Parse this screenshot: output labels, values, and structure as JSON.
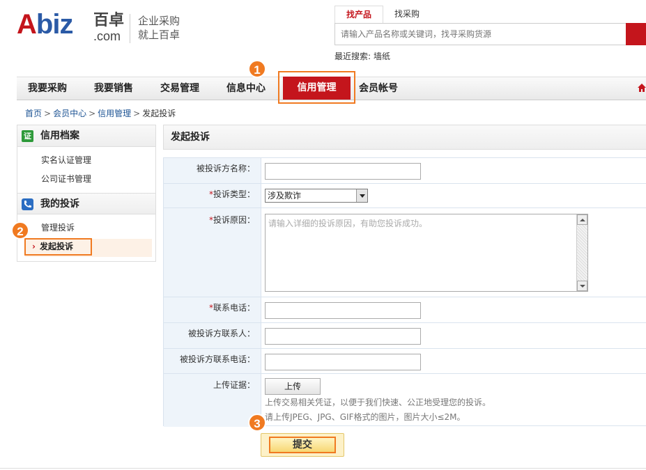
{
  "logo": {
    "mark_a": "A",
    "mark_biz": "biz",
    "cn": "百卓",
    "com": ".com",
    "slogan_1": "企业采购",
    "slogan_2": "就上百卓"
  },
  "search": {
    "tabs": [
      "找产品",
      "找采购"
    ],
    "placeholder": "请输入产品名称或关键词，找寻采购货源",
    "recent_label": "最近搜索:",
    "recent_items": [
      "墙纸"
    ]
  },
  "nav": {
    "items": [
      "我要采购",
      "我要销售",
      "交易管理",
      "信息中心",
      "信用管理",
      "会员帐号"
    ],
    "active": "信用管理"
  },
  "badges": [
    "1",
    "2",
    "3"
  ],
  "breadcrumb": [
    "首页",
    "会员中心",
    "信用管理",
    "发起投诉"
  ],
  "sidebar": {
    "sections": [
      {
        "title": "信用档案",
        "icon": "certificate-icon",
        "icon_text": "证",
        "items": [
          "实名认证管理",
          "公司证书管理"
        ]
      },
      {
        "title": "我的投诉",
        "icon": "phone-icon",
        "items": [
          "管理投诉",
          "发起投诉"
        ]
      }
    ],
    "current": "发起投诉"
  },
  "main": {
    "title": "发起投诉",
    "form": {
      "name_label": "被投诉方名称：",
      "type_label": "投诉类型：",
      "type_value": "涉及欺诈",
      "reason_label": "投诉原因：",
      "reason_placeholder": "请输入详细的投诉原因，有助您投诉成功。",
      "phone_label": "联系电话：",
      "contact_label": "被投诉方联系人：",
      "contact_phone_label": "被投诉方联系电话：",
      "evidence_label": "上传证据：",
      "upload_button": "上传",
      "hint_1": "上传交易相关凭证，以便于我们快速、公正地受理您的投诉。",
      "hint_2": "请上传JPEG、JPG、GIF格式的图片，图片大小≤2M。",
      "required_mark": "*",
      "submit": "提交"
    }
  },
  "colors": {
    "brand_red": "#c4151c",
    "highlight_orange": "#f07a21",
    "link_blue": "#1e5494"
  }
}
